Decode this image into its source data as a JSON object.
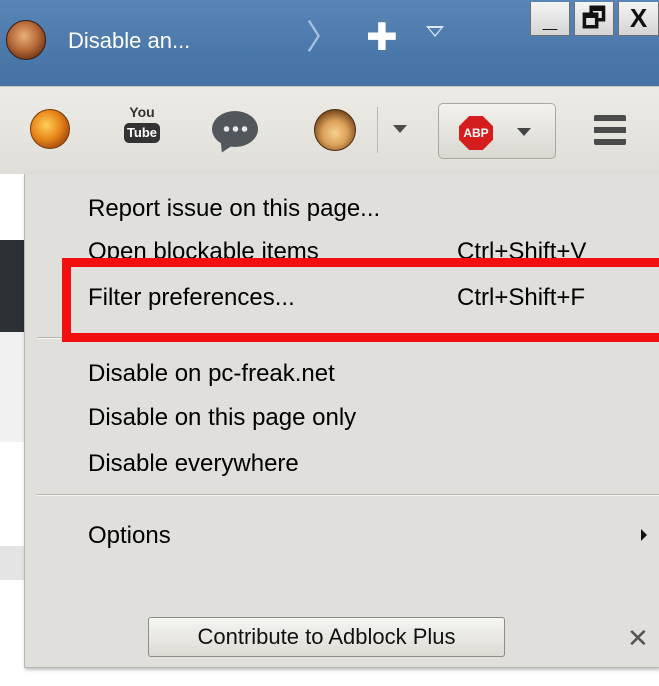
{
  "window": {
    "tab_title": "Disable an...",
    "tab_scroll_glyph": "〉",
    "new_tab_glyph": "✚",
    "minimize_glyph": "_",
    "restore_glyph": "🗗",
    "close_glyph": "X"
  },
  "toolbar": {
    "youtube_top": "You",
    "youtube_bottom": "Tube",
    "abp_label": "ABP",
    "icons": [
      "firefox-icon",
      "youtube-icon",
      "chat-icon",
      "monkey-icon",
      "abp-icon",
      "hamburger-menu-icon"
    ]
  },
  "menu": {
    "items": [
      {
        "label": "Report issue on this page...",
        "shortcut": ""
      },
      {
        "label": "Open blockable items",
        "shortcut": "Ctrl+Shift+V"
      },
      {
        "label": "Filter preferences...",
        "shortcut": "Ctrl+Shift+F"
      },
      {
        "label": "Disable on pc-freak.net",
        "shortcut": ""
      },
      {
        "label": "Disable on this page only",
        "shortcut": ""
      },
      {
        "label": "Disable everywhere",
        "shortcut": ""
      },
      {
        "label": "Options",
        "shortcut": ""
      }
    ],
    "contribute_label": "Contribute to Adblock Plus",
    "close_glyph": "✕"
  },
  "colors": {
    "annotation": "#f20f0f",
    "abp_red": "#d61d1d",
    "titlebar_blue": "#4b78aa",
    "menu_background": "#e0dfdb"
  }
}
